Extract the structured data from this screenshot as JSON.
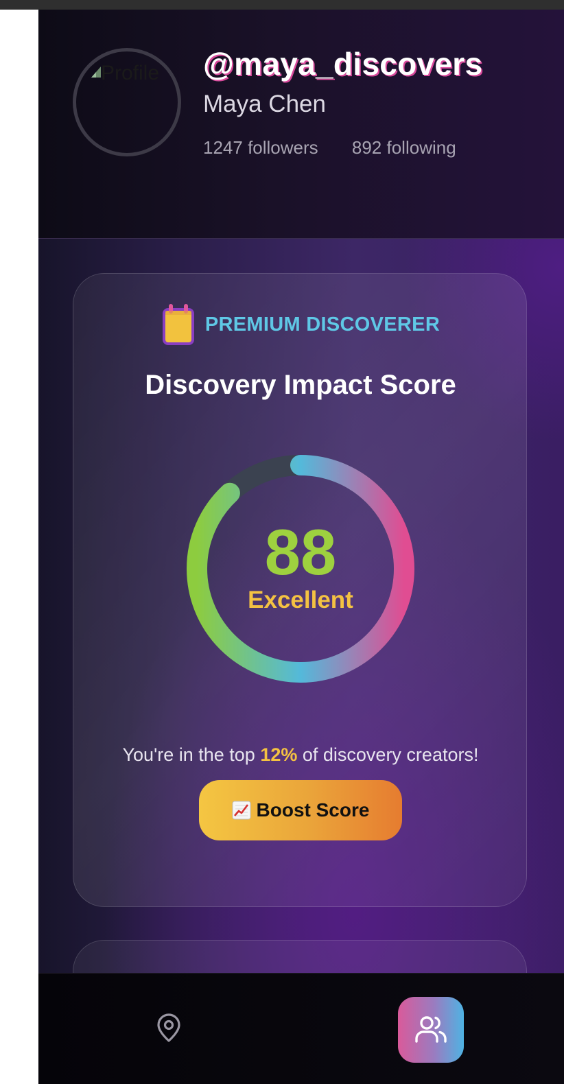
{
  "profile": {
    "avatar_alt": "Profile",
    "username": "@maya_discovers",
    "display_name": "Maya Chen",
    "followers": "1247 followers",
    "following": "892 following"
  },
  "score_card": {
    "badge": "PREMIUM DISCOVERER",
    "badge_icon": "trophy-icon",
    "title": "Discovery Impact Score",
    "score": "88",
    "score_fraction": 0.88,
    "rating": "Excellent",
    "rank_prefix": "You're in the top ",
    "rank_percent": "12%",
    "rank_suffix": " of discovery creators!",
    "boost_label": "Boost Score",
    "boost_icon": "chart-increasing-icon"
  },
  "bottom_nav": {
    "items": [
      {
        "icon": "map-pin-icon",
        "active": false
      },
      {
        "icon": "users-icon",
        "active": true
      }
    ]
  },
  "colors": {
    "score": "#9ed13f",
    "rating": "#f4c242",
    "badge": "#5fc8e6",
    "gauge_track": "#3b4250",
    "gauge_gradient": [
      "#8dcc3f",
      "#54b9da",
      "#e04d92"
    ]
  }
}
